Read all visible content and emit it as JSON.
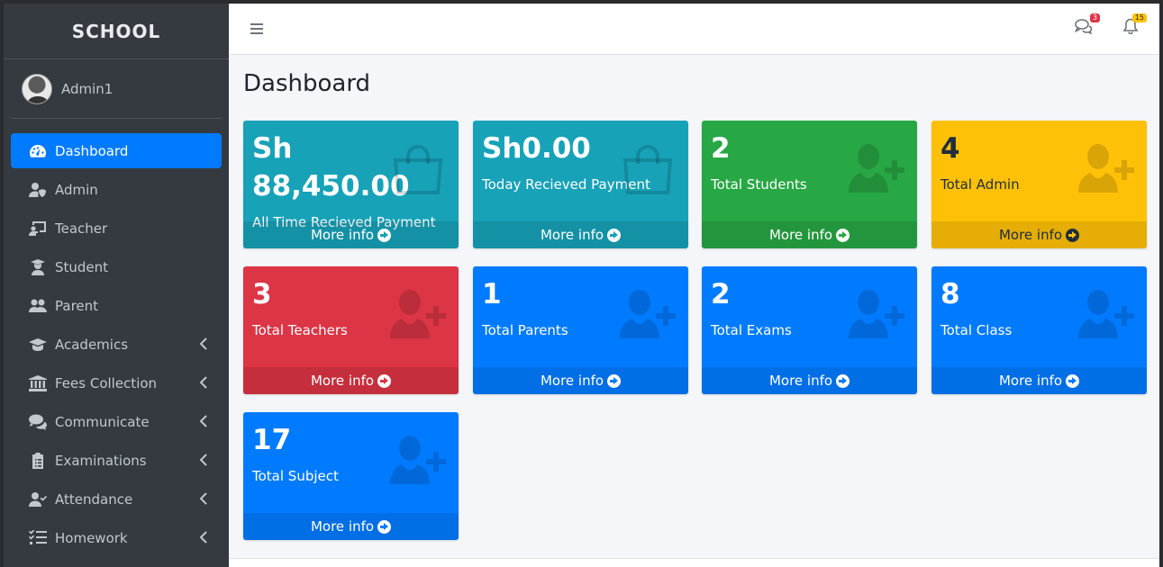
{
  "brand": "SCHOOL",
  "user": {
    "name": "Admin1"
  },
  "sidebar": {
    "items": [
      {
        "label": "Dashboard",
        "icon": "tachometer-icon",
        "active": true,
        "caret": false
      },
      {
        "label": "Admin",
        "icon": "user-shield-icon",
        "active": false,
        "caret": false
      },
      {
        "label": "Teacher",
        "icon": "chalkboard-teacher-icon",
        "active": false,
        "caret": false
      },
      {
        "label": "Student",
        "icon": "user-graduate-icon",
        "active": false,
        "caret": false
      },
      {
        "label": "Parent",
        "icon": "users-icon",
        "active": false,
        "caret": false
      },
      {
        "label": "Academics",
        "icon": "graduation-cap-icon",
        "active": false,
        "caret": true
      },
      {
        "label": "Fees Collection",
        "icon": "university-icon",
        "active": false,
        "caret": true
      },
      {
        "label": "Communicate",
        "icon": "comments-icon",
        "active": false,
        "caret": true
      },
      {
        "label": "Examinations",
        "icon": "clipboard-list-icon",
        "active": false,
        "caret": true
      },
      {
        "label": "Attendance",
        "icon": "user-check-icon",
        "active": false,
        "caret": true
      },
      {
        "label": "Homework",
        "icon": "tasks-icon",
        "active": false,
        "caret": true
      }
    ]
  },
  "navbar": {
    "messages_badge": "3",
    "notifications_badge": "15"
  },
  "page": {
    "title": "Dashboard"
  },
  "boxes": [
    {
      "value": "Sh 88,450.00",
      "label": "All Time Recieved Payment",
      "link": "More info",
      "color": "#17a2b8",
      "icon": "shopping-bag-icon"
    },
    {
      "value": "Sh0.00",
      "label": "Today Recieved Payment",
      "link": "More info",
      "color": "#17a2b8",
      "icon": "shopping-bag-icon"
    },
    {
      "value": "2",
      "label": "Total Students",
      "link": "More info",
      "color": "#28a745",
      "icon": "user-plus-icon"
    },
    {
      "value": "4",
      "label": "Total Admin",
      "link": "More info",
      "color": "#ffc107",
      "icon": "user-plus-icon"
    },
    {
      "value": "3",
      "label": "Total Teachers",
      "link": "More info",
      "color": "#dc3545",
      "icon": "user-plus-icon"
    },
    {
      "value": "1",
      "label": "Total Parents",
      "link": "More info",
      "color": "#007bff",
      "icon": "user-plus-icon"
    },
    {
      "value": "2",
      "label": "Total Exams",
      "link": "More info",
      "color": "#007bff",
      "icon": "user-plus-icon"
    },
    {
      "value": "8",
      "label": "Total Class",
      "link": "More info",
      "color": "#007bff",
      "icon": "user-plus-icon"
    },
    {
      "value": "17",
      "label": "Total Subject",
      "link": "More info",
      "color": "#007bff",
      "icon": "user-plus-icon"
    }
  ]
}
